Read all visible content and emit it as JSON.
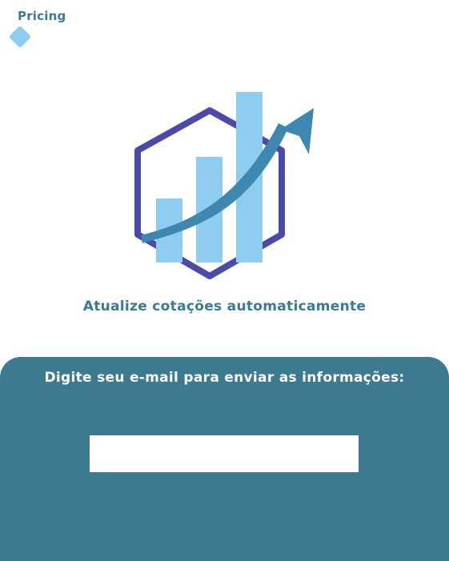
{
  "brand": {
    "name": "Pricing"
  },
  "hero": {
    "tagline": "Atualize cotações automaticamente"
  },
  "email_panel": {
    "prompt": "Digite seu e-mail para enviar as informações:",
    "input_value": "",
    "input_placeholder": ""
  },
  "colors": {
    "brand_teal": "#3a7a93",
    "panel_bg": "#3d7a90",
    "hexagon": "#4a4aa8",
    "bar_light": "#8ecdf0",
    "arrow": "#3e87b0"
  },
  "icons": {
    "logo_mark": "diamond",
    "hero_graphic": "growth-chart-hexagon"
  }
}
